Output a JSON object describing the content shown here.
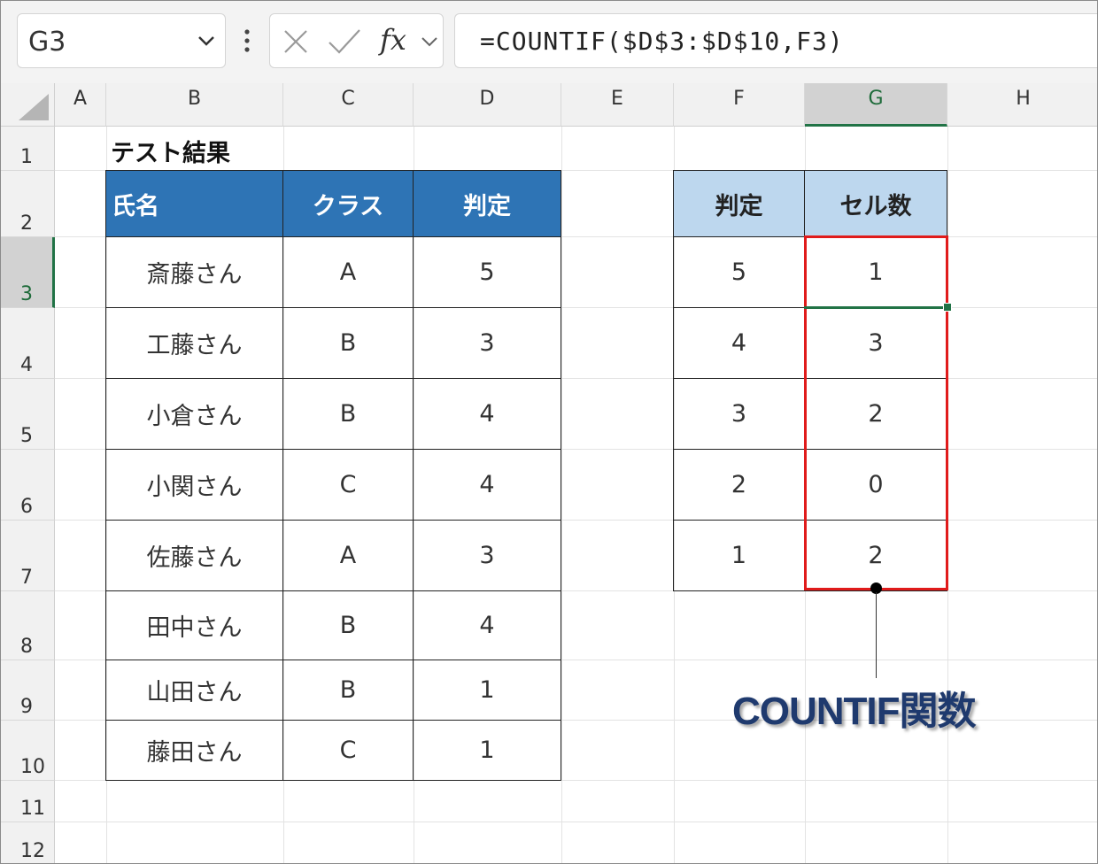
{
  "formula_bar": {
    "name_box": "G3",
    "fx_label": "fx",
    "formula": "=COUNTIF($D$3:$D$10,F3)"
  },
  "columns": [
    "A",
    "B",
    "C",
    "D",
    "E",
    "F",
    "G",
    "H"
  ],
  "rows": [
    "1",
    "2",
    "3",
    "4",
    "5",
    "6",
    "7",
    "8",
    "9",
    "10",
    "11",
    "12"
  ],
  "selected_cell": {
    "column": "G",
    "row": "3"
  },
  "sheet_title": "テスト結果",
  "left_table": {
    "headers": [
      "氏名",
      "クラス",
      "判定"
    ],
    "rows": [
      [
        "斎藤さん",
        "A",
        "5"
      ],
      [
        "工藤さん",
        "B",
        "3"
      ],
      [
        "小倉さん",
        "B",
        "4"
      ],
      [
        "小関さん",
        "C",
        "4"
      ],
      [
        "佐藤さん",
        "A",
        "3"
      ],
      [
        "田中さん",
        "B",
        "4"
      ],
      [
        "山田さん",
        "B",
        "1"
      ],
      [
        "藤田さん",
        "C",
        "1"
      ]
    ]
  },
  "right_table": {
    "headers": [
      "判定",
      "セル数"
    ],
    "rows": [
      [
        "5",
        "1"
      ],
      [
        "4",
        "3"
      ],
      [
        "3",
        "2"
      ],
      [
        "2",
        "0"
      ],
      [
        "1",
        "2"
      ]
    ]
  },
  "callout": "COUNTIF関数",
  "colors": {
    "header_dark": "#2e74b5",
    "header_light": "#bdd7ee",
    "highlight_red": "#e01b1b",
    "selection_green": "#217346",
    "callout_text": "#1f3a6e"
  }
}
